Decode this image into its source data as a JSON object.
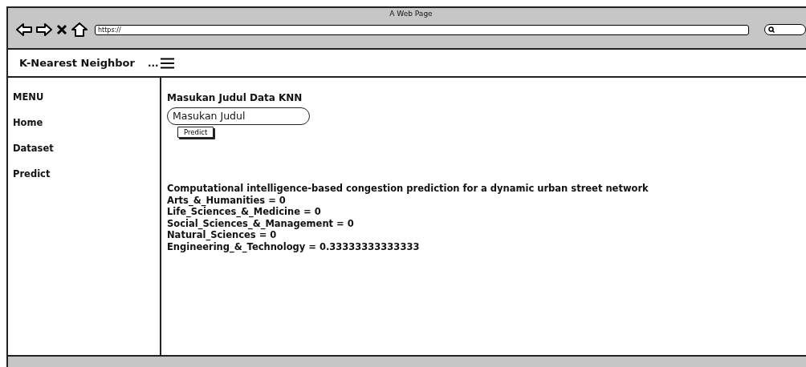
{
  "window": {
    "title": "A Web Page",
    "url": "https://"
  },
  "header": {
    "brand": "K-Nearest Neighbor",
    "menu_text": "..."
  },
  "sidebar": {
    "heading": "MENU",
    "items": [
      {
        "label": "Home"
      },
      {
        "label": "Dataset"
      },
      {
        "label": "Predict"
      }
    ]
  },
  "form": {
    "heading": "Masukan Judul Data KNN",
    "input_value": "Masukan Judul",
    "button": "Predict"
  },
  "result": {
    "title": "Computational intelligence-based congestion prediction for a dynamic urban street network",
    "scores": [
      "Arts_&_Humanities = 0",
      "Life_Sciences_&_Medicine = 0",
      "Social_Sciences_&_Management = 0",
      "Natural_Sciences = 0",
      "Engineering_&_Technology = 0.33333333333333"
    ]
  }
}
